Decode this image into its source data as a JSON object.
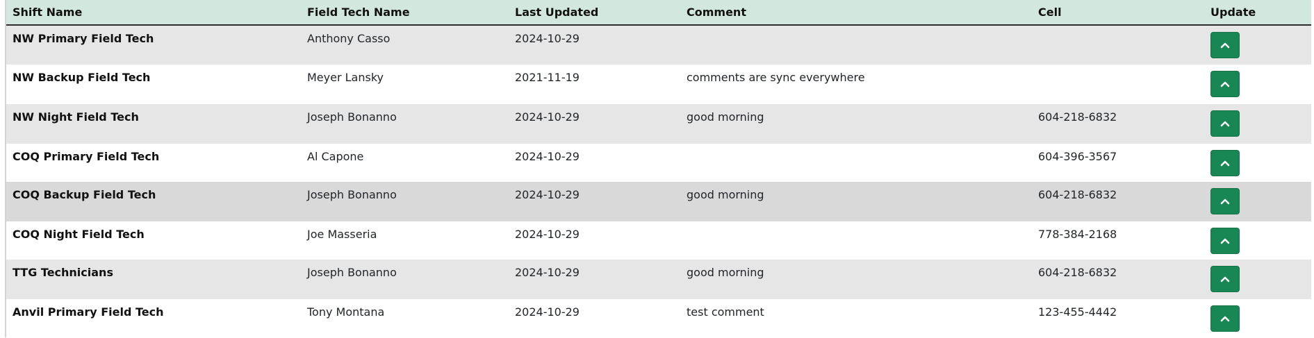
{
  "table": {
    "headers": {
      "shift_name": "Shift Name",
      "field_tech_name": "Field Tech Name",
      "last_updated": "Last Updated",
      "comment": "Comment",
      "cell": "Cell",
      "update": "Update"
    },
    "rows": [
      {
        "shift_name": "NW Primary Field Tech",
        "field_tech_name": "Anthony Casso",
        "last_updated": "2024-10-29",
        "comment": "",
        "cell": ""
      },
      {
        "shift_name": "NW Backup Field Tech",
        "field_tech_name": "Meyer Lansky",
        "last_updated": "2021-11-19",
        "comment": "comments are sync everywhere",
        "cell": ""
      },
      {
        "shift_name": "NW Night Field Tech",
        "field_tech_name": "Joseph Bonanno",
        "last_updated": "2024-10-29",
        "comment": "good morning",
        "cell": "604-218-6832"
      },
      {
        "shift_name": "COQ Primary Field Tech",
        "field_tech_name": "Al Capone",
        "last_updated": "2024-10-29",
        "comment": "",
        "cell": "604-396-3567"
      },
      {
        "shift_name": "COQ Backup Field Tech",
        "field_tech_name": "Joseph Bonanno",
        "last_updated": "2024-10-29",
        "comment": "good morning",
        "cell": "604-218-6832"
      },
      {
        "shift_name": "COQ Night Field Tech",
        "field_tech_name": "Joe Masseria",
        "last_updated": "2024-10-29",
        "comment": "",
        "cell": "778-384-2168"
      },
      {
        "shift_name": "TTG Technicians",
        "field_tech_name": "Joseph Bonanno",
        "last_updated": "2024-10-29",
        "comment": "good morning",
        "cell": "604-218-6832"
      },
      {
        "shift_name": "Anvil Primary Field Tech",
        "field_tech_name": "Tony Montana",
        "last_updated": "2024-10-29",
        "comment": "test comment",
        "cell": "123-455-4442"
      }
    ],
    "update_icon": "chevron-up-icon",
    "colors": {
      "header_bg": "#d2e7dd",
      "row_stripe": "#e6e6e6",
      "row_hover": "#d9d9d9",
      "button_bg": "#198754",
      "button_icon": "#ffffff"
    }
  }
}
